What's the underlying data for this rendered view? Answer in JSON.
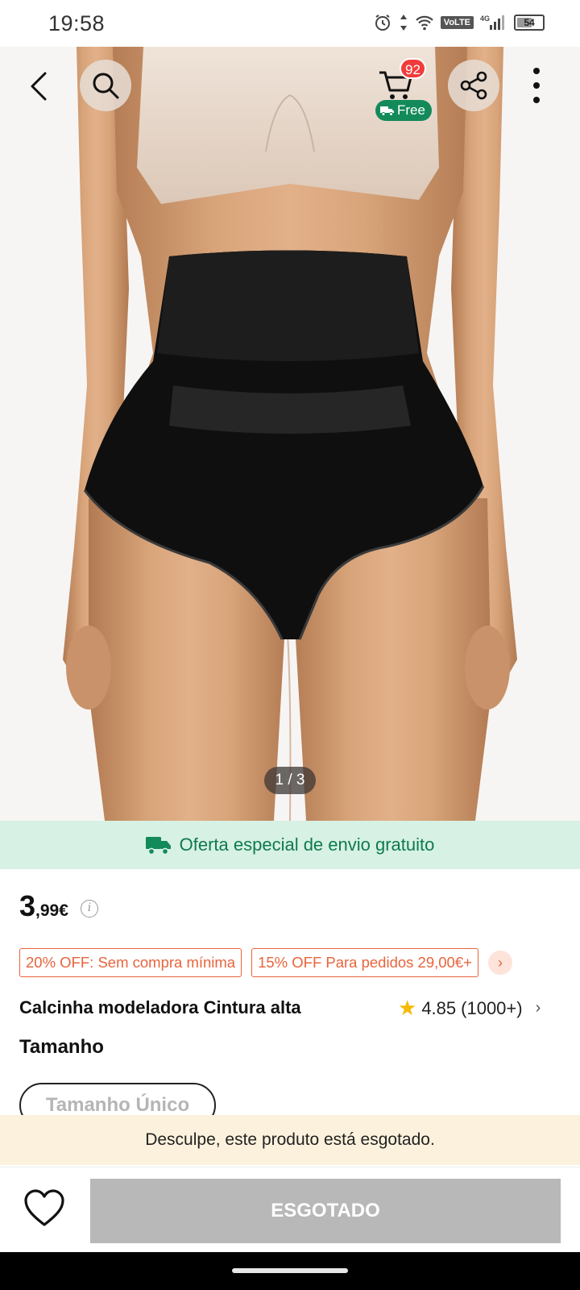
{
  "status_bar": {
    "time": "19:58",
    "icons": [
      "alarm-icon",
      "data-arrows-icon",
      "wifi-icon",
      "volte-badge",
      "signal-4g-icon",
      "battery-icon"
    ],
    "volte": "VoLTE",
    "network": "4G",
    "battery": "54"
  },
  "nav": {
    "back_icon": "chevron-left-icon",
    "search_icon": "search-icon",
    "cart_icon": "cart-icon",
    "cart_count": "92",
    "cart_free": "Free",
    "share_icon": "share-icon",
    "more_icon": "more-vertical-icon"
  },
  "gallery": {
    "pager": "1 / 3",
    "image_alt_icon": "product-photo"
  },
  "shipping_banner": {
    "icon": "delivery-truck-icon",
    "text": "Oferta especial de envio gratuito",
    "color": "#0f7a4d"
  },
  "price": {
    "integer": "3",
    "decimal": ",99€",
    "info_icon": "info-icon"
  },
  "coupons": [
    {
      "label": "20% OFF: Sem compra mínima"
    },
    {
      "label": "15% OFF Para pedidos 29,00€+"
    }
  ],
  "product": {
    "title": "Calcinha modeladora Cintura alta",
    "rating": "4.85",
    "reviews": "(1000+)"
  },
  "size": {
    "heading": "Tamanho",
    "options": [
      "Tamanho Único"
    ]
  },
  "notice": {
    "text": "Desculpe, este produto está esgotado."
  },
  "actions": {
    "wishlist_icon": "heart-icon",
    "soldout_label": "ESGOTADO"
  },
  "colors": {
    "accent_orange": "#e8643c",
    "green": "#138a5a",
    "badge_red": "#f23b3b",
    "star": "#f6b900"
  }
}
